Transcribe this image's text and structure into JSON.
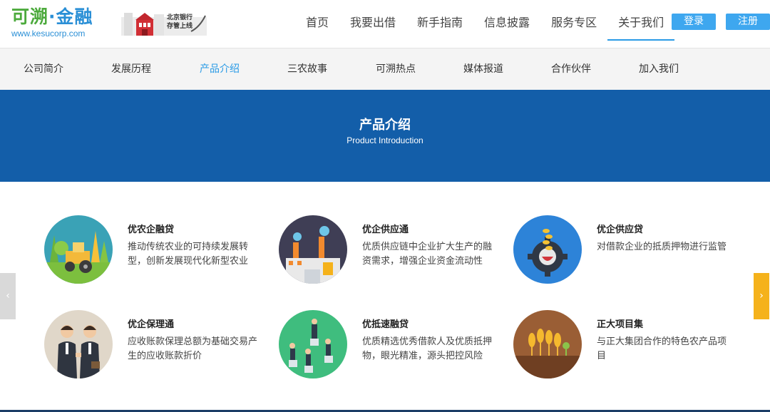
{
  "header": {
    "logo_text_1": "可溯",
    "logo_text_2": "金融",
    "logo_url": "www.kesucorp.com",
    "bank_badge_line1": "北京银行",
    "bank_badge_line2": "存管上线",
    "nav": [
      "首页",
      "我要出借",
      "新手指南",
      "信息披露",
      "服务专区",
      "关于我们"
    ],
    "active_nav": "关于我们",
    "login_label": "登录",
    "register_label": "注册"
  },
  "subnav": {
    "items": [
      "公司简介",
      "发展历程",
      "产品介绍",
      "三农故事",
      "可溯热点",
      "媒体报道",
      "合作伙伴",
      "加入我们"
    ],
    "active": "产品介绍"
  },
  "banner": {
    "title": "产品介绍",
    "subtitle": "Product Introduction"
  },
  "products": [
    {
      "title": "优农企融贷",
      "desc": "推动传统农业的可持续发展转型，创新发展现代化新型农业",
      "icon": "tractor-farm-icon"
    },
    {
      "title": "优企供应通",
      "desc": "优质供应链中企业扩大生产的融资需求，增强企业资金流动性",
      "icon": "factory-icon"
    },
    {
      "title": "优企供应贷",
      "desc": "对借款企业的抵质押物进行监管",
      "icon": "gear-coins-icon"
    },
    {
      "title": "优企保理通",
      "desc": "应收账款保理总额为基础交易产生的应收账款折价",
      "icon": "handshake-icon"
    },
    {
      "title": "优抵速融贷",
      "desc": "优质精选优秀借款人及优质抵押物，眼光精准，源头把控风险",
      "icon": "people-pillars-icon"
    },
    {
      "title": "正大项目集",
      "desc": "与正大集团合作的特色农产品项目",
      "icon": "wheat-icon"
    }
  ],
  "colors": {
    "accent": "#2a9be6",
    "banner_bg": "#135ea9",
    "button_bg": "#3ea7ef",
    "arrow_right": "#f5b21b"
  },
  "carousel": {
    "prev_label": "‹",
    "next_label": "›"
  }
}
